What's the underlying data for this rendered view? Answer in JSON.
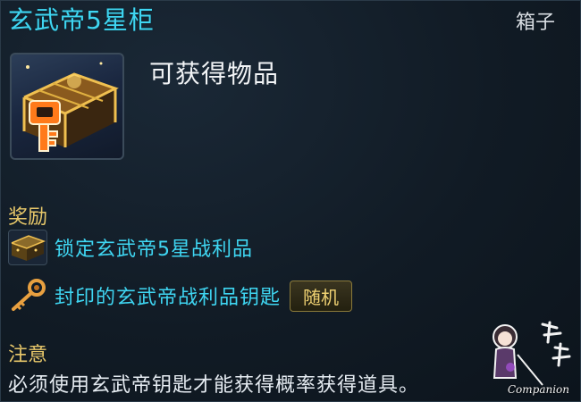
{
  "tooltip": {
    "title": "玄武帝5星柜",
    "item_type": "箱子",
    "obtain_label": "可获得物品",
    "reward_heading": "奖励",
    "rewards": [
      {
        "label": "锁定玄武帝5星战利品",
        "icon": "locked-chest-icon"
      },
      {
        "label": "封印的玄武帝战利品钥匙",
        "icon": "key-icon",
        "badge": "随机"
      }
    ],
    "note_heading": "注意",
    "note_text": "必须使用玄武帝钥匙才能获得概率获得道具。"
  },
  "watermark": {
    "text": "Companion"
  },
  "colors": {
    "title": "#3fd6f2",
    "heading": "#e8c86a",
    "reward_text": "#3fd6f2",
    "background": "#111b25"
  }
}
